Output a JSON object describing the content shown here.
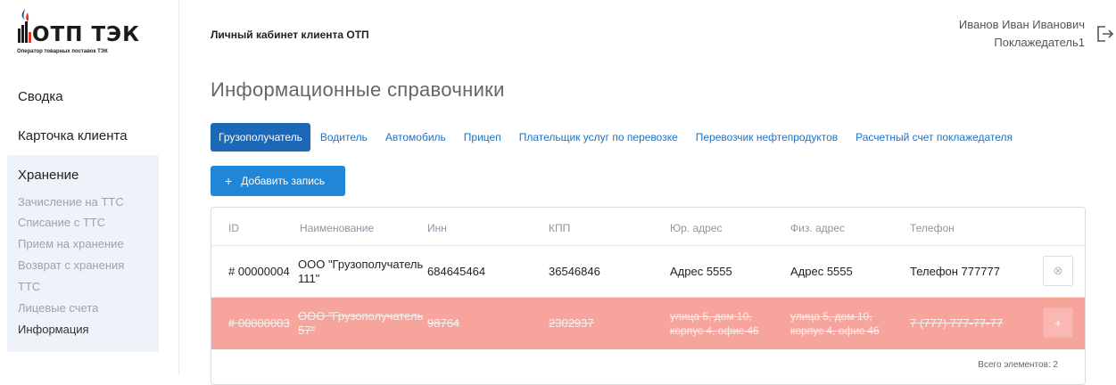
{
  "logo": {
    "name": "ОТП ТЭК",
    "subtitle": "Оператор товарных поставок ТЭК"
  },
  "sidebar": {
    "svodka": "Сводка",
    "client_card": "Карточка клиента",
    "storage_title": "Хранение",
    "storage_items": [
      "Зачисление на ТТС",
      "Списание с ТТС",
      "Прием на хранение",
      "Возврат с хранения",
      "ТТС",
      "Лицевые счета",
      "Информация"
    ]
  },
  "header": {
    "title": "Личный кабинет клиента ОТП",
    "user_name": "Иванов Иван Иванович",
    "user_role": "Поклажедатель1"
  },
  "page": {
    "title": "Информационные справочники"
  },
  "tabs": [
    "Грузополучатель",
    "Водитель",
    "Автомобиль",
    "Прицеп",
    "Плательщик услуг по перевозке",
    "Перевозчик нефтепродуктов",
    "Расчетный счет поклажедателя"
  ],
  "add_button": {
    "label": "Добавить запись",
    "icon": "plus-icon"
  },
  "table": {
    "headers": [
      "ID",
      "Наименование",
      "Инн",
      "КПП",
      "Юр. адрес",
      "Физ. адрес",
      "Телефон"
    ],
    "rows": [
      {
        "id": "# 00000004",
        "name_l1": "ООО \"Грузополучатель",
        "name_l2": "111\"",
        "inn": "684645464",
        "kpp": "36546846",
        "ur_l1": "Адрес 5555",
        "ur_l2": "",
        "fiz_l1": "Адрес 5555",
        "fiz_l2": "",
        "phone": "Телефон 777777",
        "action_icon": "remove-circle-icon",
        "action": "⊗",
        "deleted": false
      },
      {
        "id": "# 00000003",
        "name_l1": "ООО \"Грузополучатель",
        "name_l2": "57\"",
        "inn": "98764",
        "kpp": "2302937",
        "ur_l1": "улица 5, дом 10,",
        "ur_l2": "корпус 4, офис 46",
        "fiz_l1": "улица 5, дом 10,",
        "fiz_l2": "корпус 4, офис 46",
        "phone": "7 (777) 777-77-77",
        "action_icon": "plus-icon",
        "action": "+",
        "deleted": true
      }
    ],
    "total": "Всего элементов: 2"
  },
  "colors": {
    "accent": "#1f86d8",
    "tab_active": "#1c68b8",
    "deleted_row": "#f7a59c",
    "logo_red": "#e23a2b",
    "logo_blue": "#1b4f9c"
  }
}
